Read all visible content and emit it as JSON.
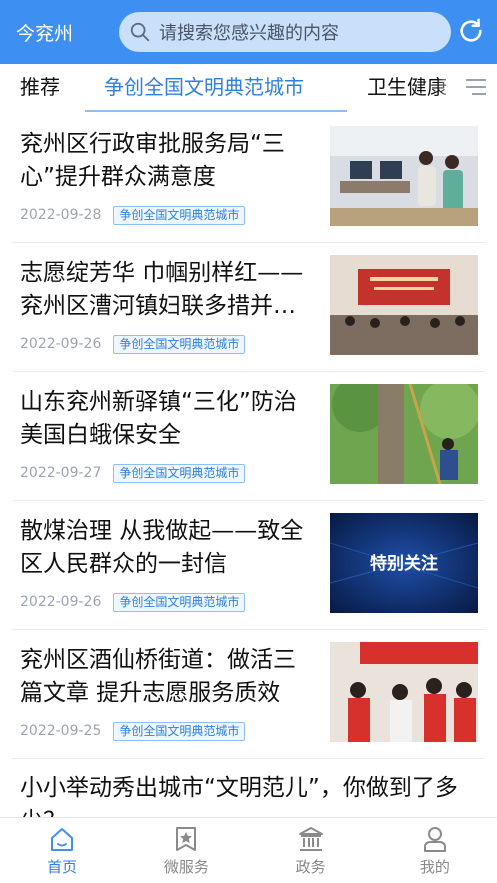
{
  "header": {
    "city": "今兖州",
    "search_placeholder": "请搜索您感兴趣的内容"
  },
  "tabs": [
    {
      "label": "推荐"
    },
    {
      "label": "争创全国文明典范城市"
    },
    {
      "label": "卫生健康"
    }
  ],
  "articles": [
    {
      "title": "兖州区行政审批服务局“三心”提升群众满意度",
      "date": "2022-09-28",
      "tag": "争创全国文明典范城市"
    },
    {
      "title": "志愿绽芳华 巾帼别样红——兖州区漕河镇妇联多措并…",
      "date": "2022-09-26",
      "tag": "争创全国文明典范城市"
    },
    {
      "title": "山东兖州新驿镇“三化”防治美国白蛾保安全",
      "date": "2022-09-27",
      "tag": "争创全国文明典范城市"
    },
    {
      "title": "散煤治理 从我做起——致全区人民群众的一封信",
      "date": "2022-09-26",
      "tag": "争创全国文明典范城市",
      "thumb_text": "特别关注"
    },
    {
      "title": "兖州区酒仙桥街道：做活三篇文章 提升志愿服务质效",
      "date": "2022-09-25",
      "tag": "争创全国文明典范城市"
    }
  ],
  "partial_article": {
    "title": "小小举动秀出城市“文明范儿”，你做到了多少？"
  },
  "bottom_nav": [
    {
      "label": "首页",
      "icon": "home-icon"
    },
    {
      "label": "微服务",
      "icon": "star-bookmark-icon"
    },
    {
      "label": "政务",
      "icon": "government-building-icon"
    },
    {
      "label": "我的",
      "icon": "user-icon"
    }
  ],
  "colors": {
    "primary": "#3d8ff2",
    "accent": "#2f7fe0"
  }
}
